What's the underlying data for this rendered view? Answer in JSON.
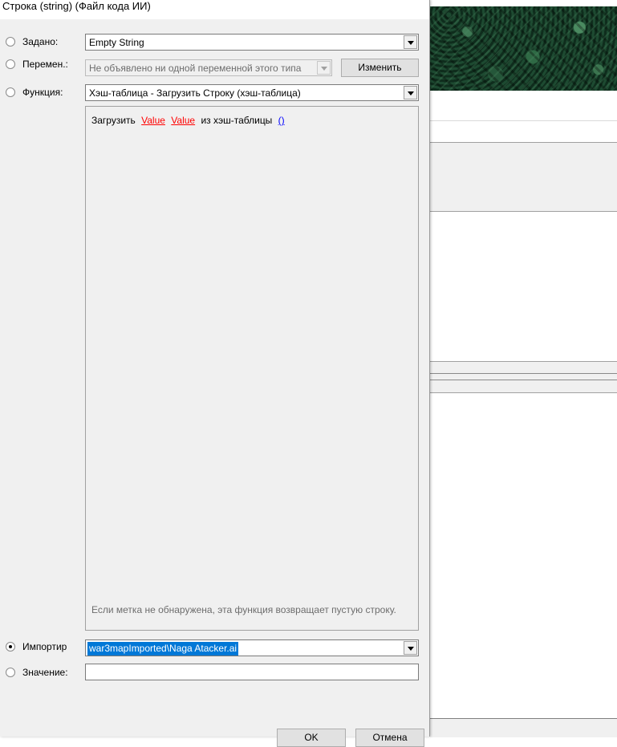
{
  "dialog": {
    "title": "Строка (string) (Файл кода ИИ)",
    "preset": {
      "label": "Задано:",
      "value": "Empty String",
      "checked": false
    },
    "variable": {
      "label": "Перемен.:",
      "value": "Не объявлено ни одной переменной этого типа",
      "edit_button": "Изменить",
      "checked": false
    },
    "function": {
      "label": "Функция:",
      "value": "Хэш-таблица - Загрузить Строку (хэш-таблица)",
      "checked": false,
      "text_prefix": "Загрузить",
      "param1": "Value",
      "param2": "Value",
      "text_mid": "из хэш-таблицы",
      "param3": "()",
      "description": "Если метка не обнаружена, эта функция возвращает пустую строку."
    },
    "imported": {
      "label": "Импортир",
      "value": "war3mapImported\\Naga Atacker.ai",
      "checked": true
    },
    "value_field": {
      "label": "Значение:",
      "value": "",
      "checked": false
    },
    "ok_button": "OK",
    "cancel_button": "Отмена"
  },
  "colors": {
    "selection": "#0078d7",
    "param_link": "#ff0000",
    "param_link_blue": "#0000ff"
  }
}
